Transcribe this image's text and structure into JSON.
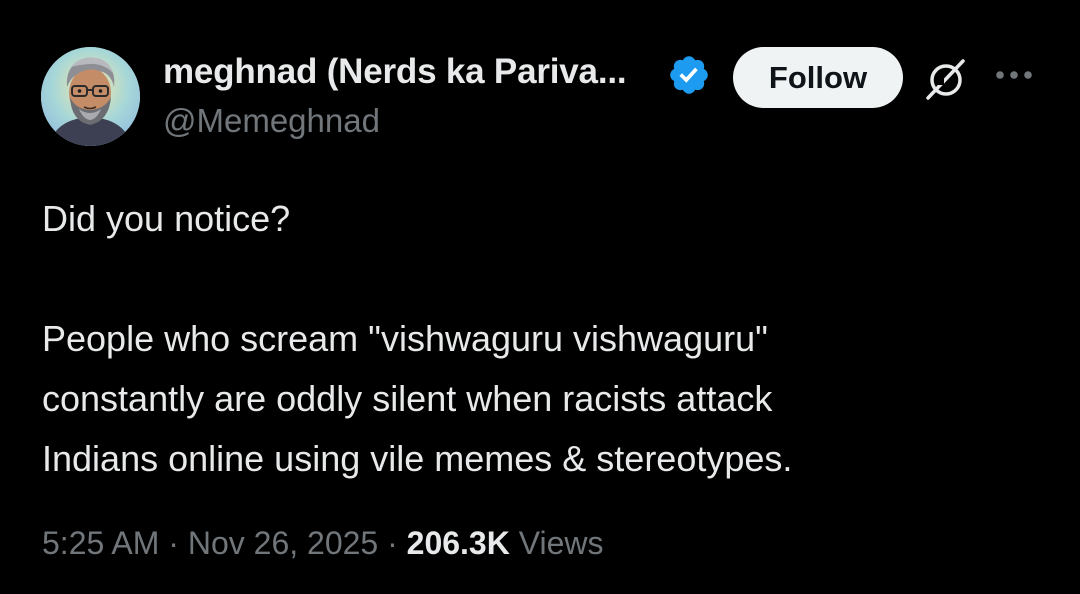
{
  "author": {
    "display_name": "meghnad (Nerds ka Pariva...",
    "handle": "@Memeghnad",
    "avatar_icon": "cartoon-avatar-bearded-man-glasses",
    "verified_icon": "verified-badge-icon",
    "verified_color": "#1d9bf0"
  },
  "actions": {
    "follow_label": "Follow",
    "grok_icon": "grok-icon",
    "more_icon": "more-options-icon"
  },
  "tweet": {
    "lines": [
      "Did you notice?",
      "People who scream \"vishwaguru vishwaguru\"",
      "constantly are oddly silent when racists attack",
      "Indians online using vile memes & stereotypes."
    ]
  },
  "meta": {
    "time": "5:25 AM",
    "sep1": " · ",
    "date": "Nov 26, 2025",
    "sep2": " · ",
    "views_count": "206.3K",
    "views_label": " Views"
  },
  "colors": {
    "background": "#000000",
    "primary_text": "#e7e9ea",
    "secondary_text": "#71767b",
    "follow_button_bg": "#eff3f4",
    "follow_button_text": "#0f1419"
  }
}
